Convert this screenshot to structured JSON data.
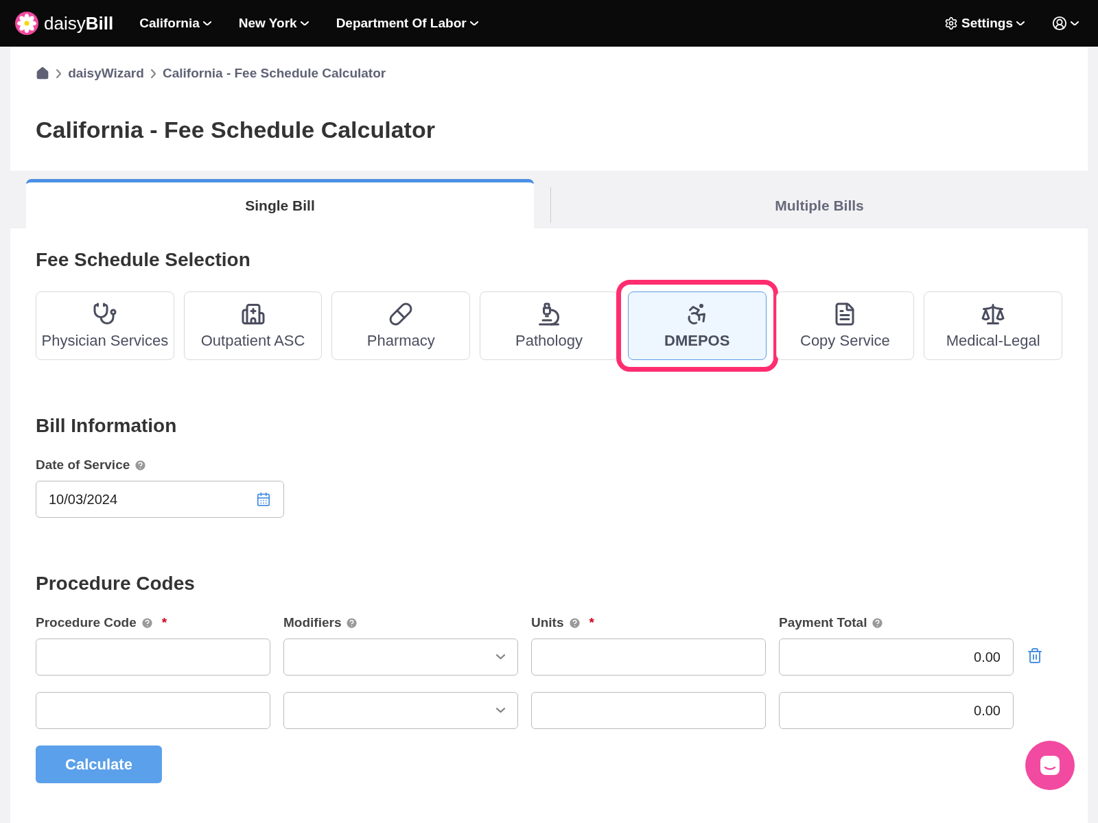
{
  "nav": {
    "brand": "daisy**Bill**",
    "menus": [
      {
        "label": "California"
      },
      {
        "label": "New York"
      },
      {
        "label": "Department Of Labor"
      }
    ],
    "settings": "Settings"
  },
  "breadcrumb": [
    "daisyWizard",
    "California - Fee Schedule Calculator"
  ],
  "title": "California - Fee Schedule Calculator",
  "tabs": [
    {
      "label": "Single Bill",
      "selected": true
    },
    {
      "label": "Multiple Bills",
      "selected": false
    }
  ],
  "fee_schedule": {
    "title": "Fee Schedule Selection",
    "options": [
      {
        "label": "Physician Services",
        "selected": false,
        "highlighted": false
      },
      {
        "label": "Outpatient ASC",
        "selected": false,
        "highlighted": false
      },
      {
        "label": "Pharmacy",
        "selected": false,
        "highlighted": false
      },
      {
        "label": "Pathology",
        "selected": false,
        "highlighted": false
      },
      {
        "label": "DMEPOS",
        "selected": true,
        "highlighted": true
      },
      {
        "label": "Copy Service",
        "selected": false,
        "highlighted": false
      },
      {
        "label": "Medical-Legal",
        "selected": false,
        "highlighted": false
      }
    ]
  },
  "bill_information": {
    "title": "Bill Information",
    "date_label": "Date of Service",
    "date_value": "10/03/2024"
  },
  "procedure_codes": {
    "title": "Procedure Codes",
    "columns": [
      {
        "label": "Procedure Code",
        "required": true
      },
      {
        "label": "Modifiers",
        "required": false
      },
      {
        "label": "Units",
        "required": true
      },
      {
        "label": "Payment Total",
        "required": false
      }
    ],
    "rows": [
      {
        "payment_total": "0.00",
        "deletable": true
      },
      {
        "payment_total": "0.00",
        "deletable": false
      }
    ],
    "required_marker": "*",
    "button": "Calculate"
  }
}
